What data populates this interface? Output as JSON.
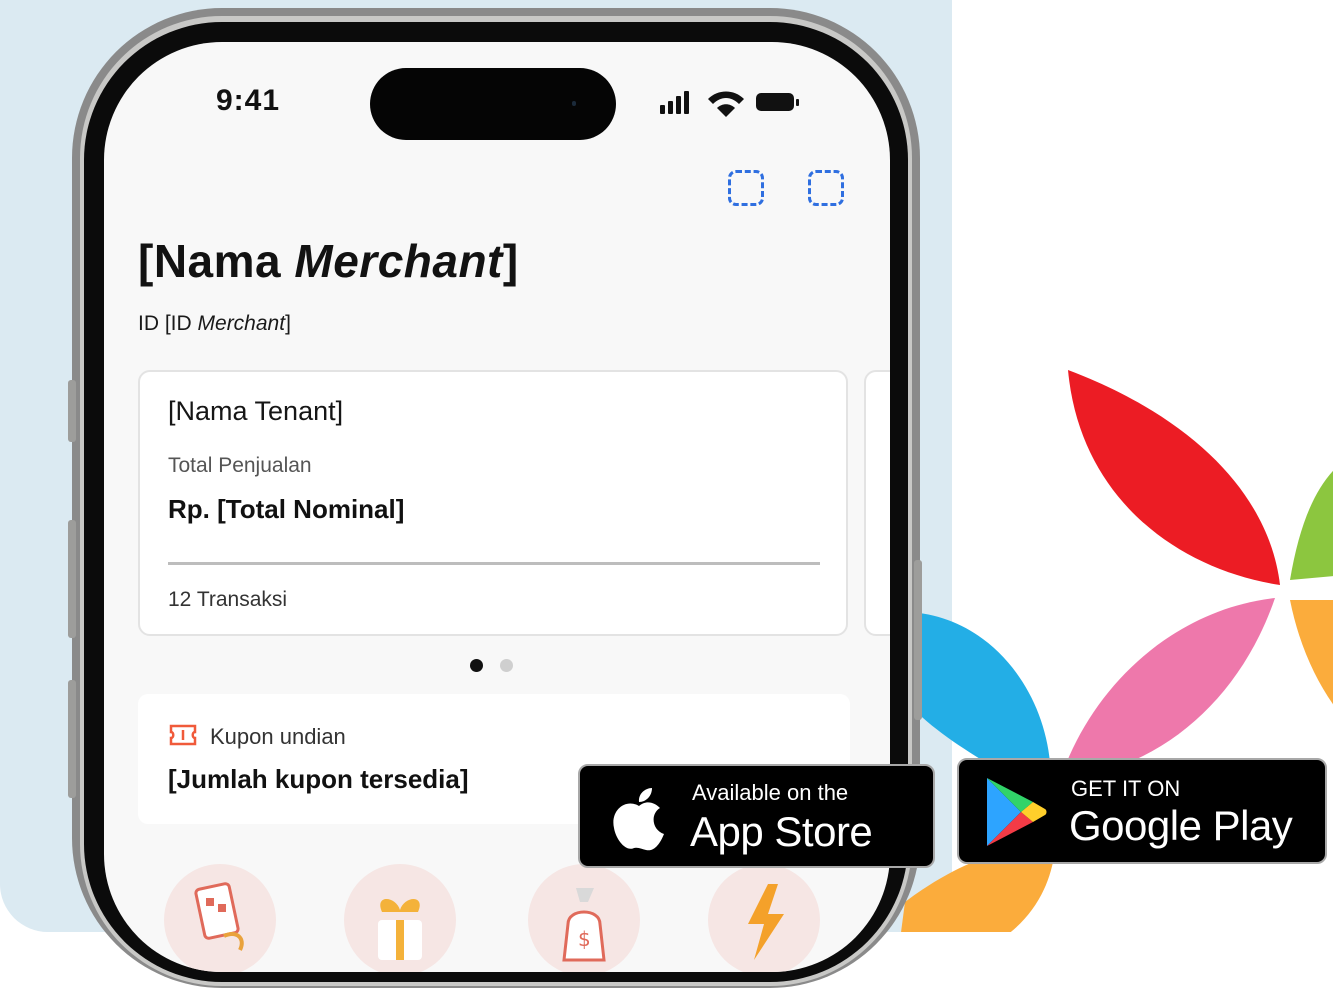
{
  "colors": {
    "background_panel": "#dbeaf2",
    "accent_blue": "#2f6fe0",
    "petal_red": "#ec1c24",
    "petal_green": "#8cc63f",
    "petal_pink": "#ee78ab",
    "petal_orange": "#fbac3c",
    "petal_blue": "#23aee6",
    "coupon_icon": "#f05a3a"
  },
  "phone": {
    "status_bar": {
      "time": "9:41",
      "icons": [
        "cellular-signal-icon",
        "wifi-icon",
        "battery-icon"
      ]
    },
    "header_actions": [
      "action-placeholder-icon",
      "action-placeholder-icon"
    ],
    "merchant": {
      "name_open": "[Nama ",
      "name_italic": "Merchant",
      "name_close": "]",
      "id_prefix": "ID [ID ",
      "id_italic": "Merchant",
      "id_suffix": "]"
    },
    "tenant_card": {
      "tenant_name": "[Nama Tenant]",
      "sales_label": "Total Penjualan",
      "sales_value": "Rp. [Total Nominal]",
      "transaction_count": "12 Transaksi"
    },
    "carousel": {
      "total_pages": 2,
      "active_page": 1
    },
    "coupon": {
      "label": "Kupon undian",
      "value": "[Jumlah kupon tersedia]",
      "icon": "ticket-icon"
    },
    "menu_icons": [
      "voucher-icon",
      "gift-icon",
      "money-bag-icon",
      "flash-icon"
    ]
  },
  "store_badges": {
    "app_store": {
      "small": "Available on the",
      "big": "App Store",
      "icon": "apple-icon"
    },
    "google_play": {
      "small": "GET IT ON",
      "big": "Google Play",
      "icon": "google-play-icon"
    }
  }
}
